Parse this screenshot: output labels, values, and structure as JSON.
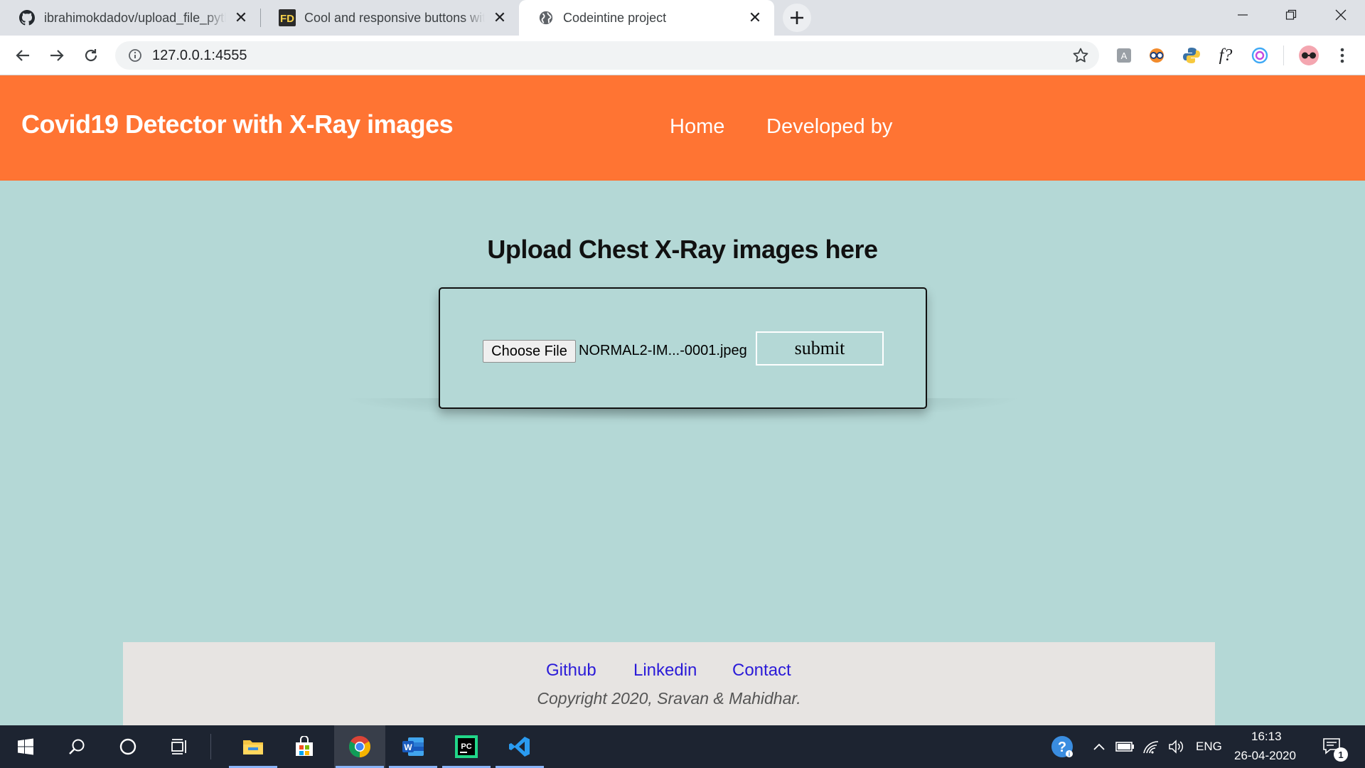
{
  "browser": {
    "tabs": [
      {
        "title": "ibrahimokdadov/upload_file_python",
        "icon": "github-icon"
      },
      {
        "title": "Cool and responsive buttons with CSS",
        "icon": "fd-icon"
      },
      {
        "title": "Codeintine project",
        "icon": "globe-icon",
        "active": true
      }
    ],
    "url": "127.0.0.1:4555"
  },
  "header": {
    "title": "Covid19 Detector with X-Ray images",
    "nav": [
      "Home",
      "Developed by"
    ],
    "color": "#ff7433"
  },
  "main": {
    "heading": "Upload Chest X-Ray images here",
    "choose_file_label": "Choose File",
    "file_name": "NORMAL2-IM...-0001.jpeg",
    "submit_label": "submit",
    "background": "#b4d8d6"
  },
  "footer": {
    "links": [
      "Github",
      "Linkedin",
      "Contact"
    ],
    "copyright": "Copyright 2020, Sravan & Mahidhar."
  },
  "taskbar": {
    "language": "ENG",
    "time": "16:13",
    "date": "26-04-2020",
    "notification_count": "1"
  }
}
